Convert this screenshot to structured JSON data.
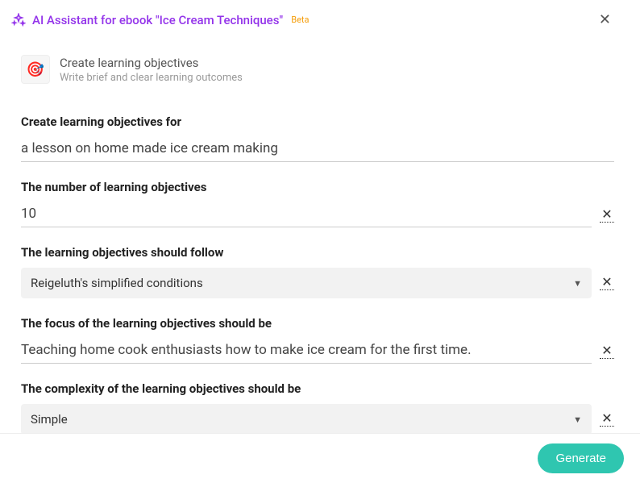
{
  "header": {
    "title": "AI Assistant for ebook \"Ice Cream Techniques\"",
    "badge": "Beta"
  },
  "task": {
    "title": "Create learning objectives",
    "subtitle": "Write brief and clear learning outcomes"
  },
  "fields": {
    "topic": {
      "label": "Create learning objectives for",
      "value": "a lesson on home made ice cream making"
    },
    "count": {
      "label": "The number of learning objectives",
      "value": "10"
    },
    "framework": {
      "label": "The learning objectives should follow",
      "value": "Reigeluth's simplified conditions"
    },
    "focus": {
      "label": "The focus of the learning objectives should be",
      "value": "Teaching home cook enthusiasts how to make ice cream for the first time."
    },
    "complexity": {
      "label": "The complexity of the learning objectives should be",
      "value": "Simple"
    }
  },
  "footer": {
    "generate": "Generate"
  }
}
